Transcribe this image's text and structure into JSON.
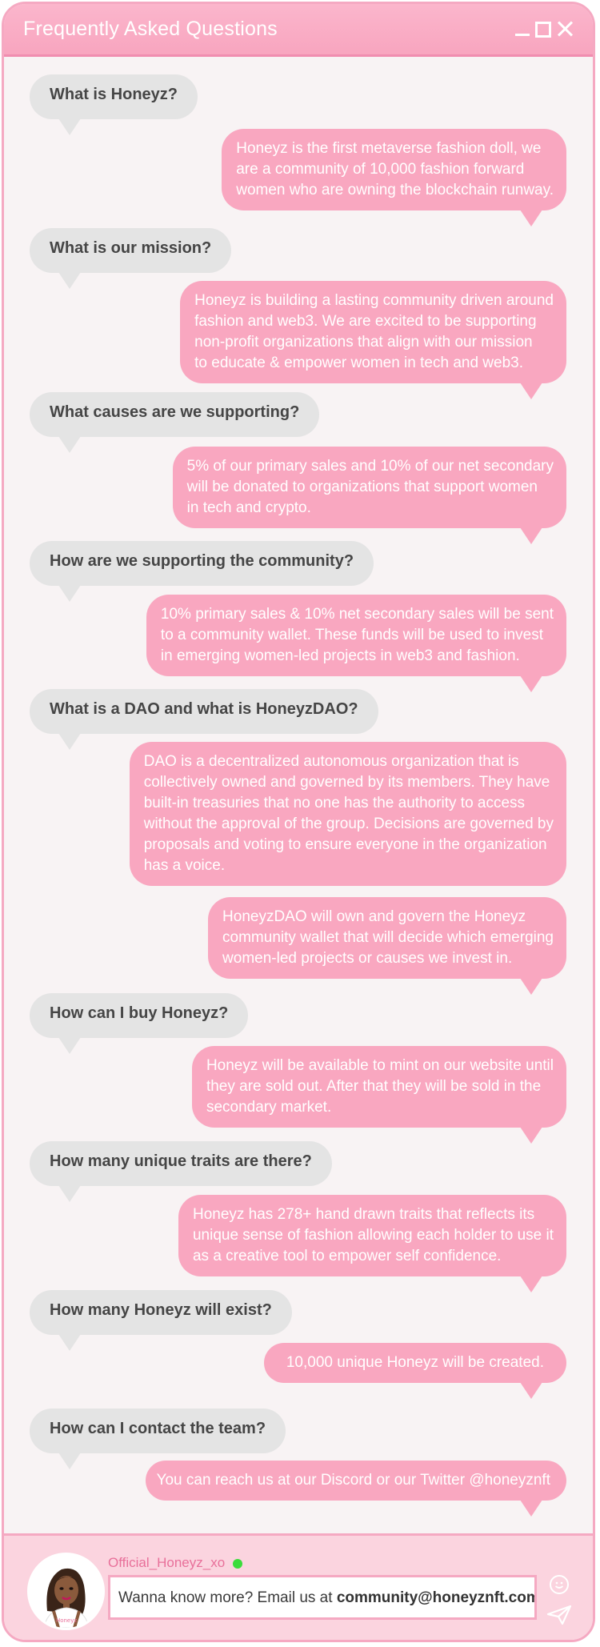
{
  "window": {
    "title": "Frequently Asked Questions"
  },
  "faq": [
    {
      "q": "What is Honeyz?",
      "a": [
        "Honeyz is the first metaverse fashion doll, we",
        "are a community of 10,000 fashion forward",
        "women who are owning the blockchain runway."
      ]
    },
    {
      "q": "What is our mission?",
      "a": [
        "Honeyz is building a lasting community driven around",
        "fashion and web3. We are excited to be supporting",
        "non-profit organizations that align with our mission",
        "to educate & empower women in tech and web3."
      ]
    },
    {
      "q": "What causes are we supporting?",
      "a": [
        "5% of our primary sales and 10% of our net secondary",
        "will be donated to organizations that support women",
        "in tech and crypto."
      ]
    },
    {
      "q": "How are we supporting the community?",
      "a": [
        "10% primary sales & 10% net secondary sales will be sent",
        "to a community wallet. These funds will be used to invest",
        "in emerging women-led projects in web3 and fashion."
      ]
    },
    {
      "q": "What is a DAO and what is HoneyzDAO?",
      "a": [
        "DAO is a decentralized autonomous organization that is",
        "collectively owned and governed by its members. They have",
        "built-in treasuries that no one has the authority to access",
        "without the approval of the group. Decisions are governed by",
        "proposals and voting to ensure everyone in the organization",
        "has a voice."
      ],
      "a2": [
        "HoneyzDAO will own and govern the Honeyz",
        "community wallet that will decide which emerging",
        "women-led projects or causes we invest in."
      ]
    },
    {
      "q": "How can I buy Honeyz?",
      "a": [
        "Honeyz will be available to mint on our website until",
        "they are sold out. After that they will be sold in the",
        "secondary market."
      ]
    },
    {
      "q": "How many unique traits are there?",
      "a": [
        "Honeyz has 278+ hand drawn traits that reflects its",
        "unique sense of fashion allowing each holder to use it",
        "as a creative tool to empower self confidence."
      ]
    },
    {
      "q": "How many Honeyz will exist?",
      "a": [
        "10,000 unique Honeyz will be created."
      ]
    },
    {
      "q": "How can I contact the team?",
      "a": [
        "You can reach us at our Discord or our Twitter @honeyznft"
      ]
    }
  ],
  "footer": {
    "username": "Official_Honeyz_xo",
    "input_text": "Wanna know more? Email us at ",
    "input_email": "community@honeyznft.com",
    "avatar_badge": "Honeyz"
  },
  "colors": {
    "bubble_pink": "#f9a7c0",
    "bubble_gray": "#e4e4e4",
    "online": "#3bdc3b"
  }
}
